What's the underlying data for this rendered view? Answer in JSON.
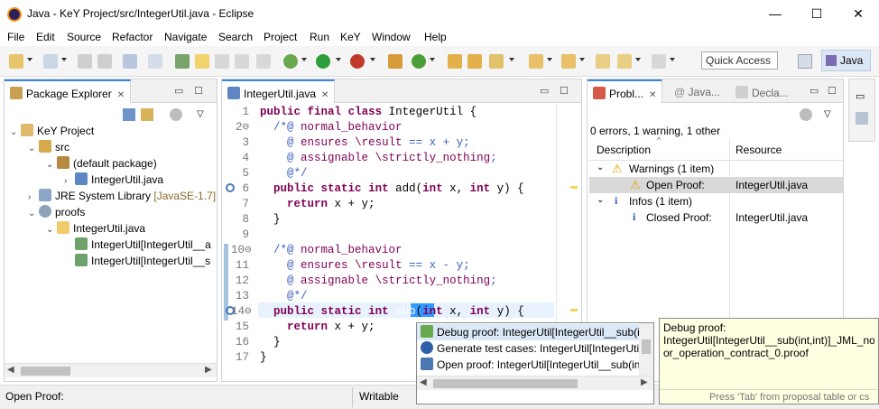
{
  "window": {
    "title": "Java - KeY Project/src/IntegerUtil.java - Eclipse",
    "minimize_glyph": "—",
    "maximize_glyph": "☐",
    "close_glyph": "✕"
  },
  "menu": [
    "File",
    "Edit",
    "Source",
    "Refactor",
    "Navigate",
    "Search",
    "Project",
    "Run",
    "KeY",
    "Window",
    "Help"
  ],
  "toolbar": {
    "quick_access": "Quick Access",
    "perspective": "Java"
  },
  "package_explorer": {
    "tab": "Package Explorer",
    "tree": [
      {
        "label": "KeY Project",
        "twisty": "⌄",
        "icon": "project-icon"
      },
      {
        "label": "src",
        "twisty": "⌄",
        "icon": "source-folder-icon"
      },
      {
        "label": "(default package)",
        "twisty": "⌄",
        "icon": "package-icon"
      },
      {
        "label": "IntegerUtil.java",
        "twisty": "›",
        "icon": "java-file-icon"
      },
      {
        "label": "JRE System Library",
        "suffix": "[JavaSE-1.7]",
        "twisty": "›",
        "icon": "library-icon"
      },
      {
        "label": "proofs",
        "twisty": "⌄",
        "icon": "proof-folder-icon"
      },
      {
        "label": "IntegerUtil.java",
        "twisty": "⌄",
        "icon": "folder-icon"
      },
      {
        "label": "IntegerUtil[IntegerUtil__a",
        "twisty": "",
        "icon": "proof-file-icon"
      },
      {
        "label": "IntegerUtil[IntegerUtil__s",
        "twisty": "",
        "icon": "proof-file-icon"
      }
    ]
  },
  "editor": {
    "tab": "IntegerUtil.java",
    "lines": [
      {
        "n": "1",
        "code": "public final class IntegerUtil {"
      },
      {
        "n": "2⊖",
        "code": "  /*@ normal_behavior"
      },
      {
        "n": "3",
        "code": "    @ ensures \\result == x + y;"
      },
      {
        "n": "4",
        "code": "    @ assignable \\strictly_nothing;"
      },
      {
        "n": "5",
        "code": "    @*/"
      },
      {
        "n": "6",
        "code": "  public static int add(int x, int y) {"
      },
      {
        "n": "7",
        "code": "    return x + y;"
      },
      {
        "n": "8",
        "code": "  }"
      },
      {
        "n": "9",
        "code": ""
      },
      {
        "n": "10⊖",
        "code": "  /*@ normal_behavior"
      },
      {
        "n": "11",
        "code": "    @ ensures \\result == x - y;"
      },
      {
        "n": "12",
        "code": "    @ assignable \\strictly_nothing;"
      },
      {
        "n": "13",
        "code": "    @*/"
      },
      {
        "n": "14⊖",
        "code": "  public static int sub(int x, int y) {"
      },
      {
        "n": "15",
        "code": "    return x + y;"
      },
      {
        "n": "16",
        "code": "  }"
      },
      {
        "n": "17",
        "code": "}"
      }
    ],
    "selected_word": "sub"
  },
  "problems": {
    "tabs": [
      "Probl...",
      "Java...",
      "Decla..."
    ],
    "summary": "0 errors, 1 warning, 1 other",
    "col_description": "Description",
    "col_resource": "Resource",
    "rows": [
      {
        "label": "Warnings (1 item)",
        "resource": "",
        "indent": 0,
        "twisty": "⌄",
        "icon": "warning-icon"
      },
      {
        "label": "Open Proof:",
        "resource": "IntegerUtil.java",
        "indent": 1,
        "twisty": "",
        "icon": "warning-icon"
      },
      {
        "label": "Infos (1 item)",
        "resource": "",
        "indent": 0,
        "twisty": "⌄",
        "icon": "info-icon"
      },
      {
        "label": "Closed Proof:",
        "resource": "IntegerUtil.java",
        "indent": 1,
        "twisty": "",
        "icon": "info-icon"
      }
    ]
  },
  "proposals": [
    {
      "label": "Debug proof: IntegerUtil[IntegerUtil__sub(i",
      "icon": "debug-proof-icon"
    },
    {
      "label": "Generate test cases: IntegerUtil[IntegerUtil_",
      "icon": "test-cases-icon"
    },
    {
      "label": "Open proof: IntegerUtil[IntegerUtil__sub(in",
      "icon": "key-icon"
    }
  ],
  "tooltip": {
    "line1": "Debug proof:",
    "line2": "IntegerUtil[IntegerUtil__sub(int,int)]_JML_noi",
    "line3": "or_operation_contract_0.proof",
    "footer": "Press 'Tab' from proposal table or cs"
  },
  "status": {
    "left": "Open Proof:",
    "mode": "Writable"
  }
}
